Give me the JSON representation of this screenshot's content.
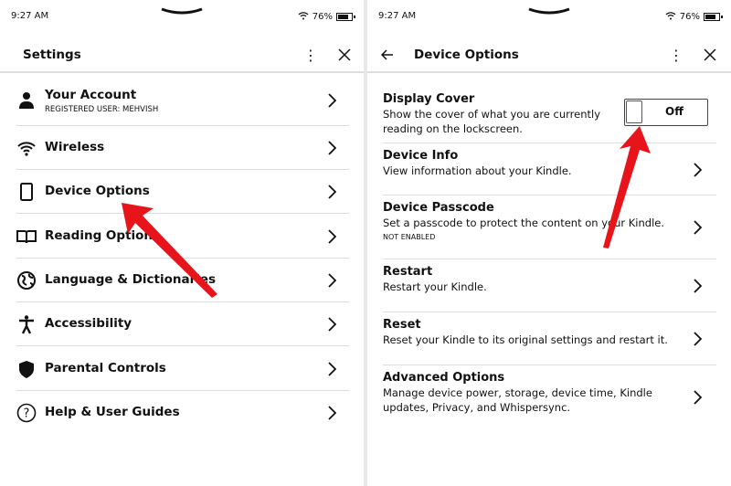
{
  "status": {
    "time": "9:27 AM",
    "battery": "76%",
    "battery_level": 0.76
  },
  "left": {
    "title": "Settings",
    "items": [
      {
        "label": "Your Account",
        "sub": "REGISTERED USER: MEHVISH",
        "icon": "person-icon"
      },
      {
        "label": "Wireless",
        "icon": "wifi-icon"
      },
      {
        "label": "Device Options",
        "icon": "device-icon"
      },
      {
        "label": "Reading Options",
        "icon": "book-icon"
      },
      {
        "label": "Language & Dictionaries",
        "icon": "globe-icon"
      },
      {
        "label": "Accessibility",
        "icon": "accessibility-icon"
      },
      {
        "label": "Parental Controls",
        "icon": "shield-icon"
      },
      {
        "label": "Help & User Guides",
        "icon": "help-icon"
      }
    ]
  },
  "right": {
    "title": "Device Options",
    "items": [
      {
        "label": "Display Cover",
        "desc": "Show the cover of what you are currently reading on the lockscreen.",
        "toggle": "Off"
      },
      {
        "label": "Device Info",
        "desc": "View information about your Kindle."
      },
      {
        "label": "Device Passcode",
        "desc": "Set a passcode to protect the content on your Kindle.",
        "note": "NOT ENABLED"
      },
      {
        "label": "Restart",
        "desc": "Restart your Kindle."
      },
      {
        "label": "Reset",
        "desc": "Reset your Kindle to its original settings and restart it."
      },
      {
        "label": "Advanced Options",
        "desc": "Manage device power, storage, device time, Kindle updates, Privacy, and Whispersync."
      }
    ]
  },
  "colors": {
    "annotation_arrow": "#e8141c"
  }
}
